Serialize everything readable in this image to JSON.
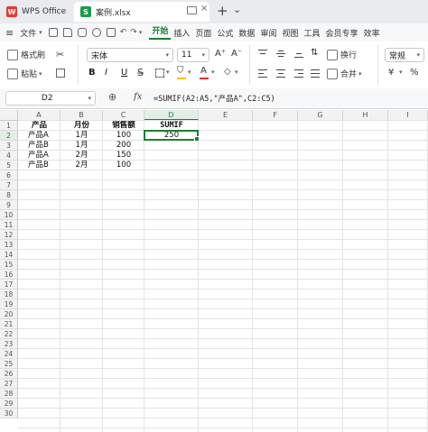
{
  "titlebar": {
    "app_tab": "WPS Office",
    "file_tab": "案例.xlsx",
    "new_tab_symbol": "+",
    "dropdown_symbol": "⌄"
  },
  "menu": {
    "file_label": "文件",
    "items": [
      "开始",
      "插入",
      "页面",
      "公式",
      "数据",
      "审阅",
      "视图",
      "工具",
      "会员专享",
      "效率"
    ],
    "active_index": 0
  },
  "ribbon": {
    "format_painter": "格式刷",
    "paste": "粘贴",
    "font_name": "宋体",
    "font_size": "11",
    "wrap_text": "换行",
    "merge": "合并",
    "number_format": "常规",
    "bold": "B",
    "italic": "I",
    "underline": "U"
  },
  "formula_bar": {
    "cell_ref": "D2",
    "fx_label": "fx",
    "formula": "=SUMIF(A2:A5,\"产品A\",C2:C5)"
  },
  "grid": {
    "columns": [
      "A",
      "B",
      "C",
      "D",
      "E",
      "F",
      "G",
      "H",
      "I"
    ],
    "selected_column": "D",
    "row_numbers": [
      "1",
      "2",
      "3",
      "4",
      "5",
      "6",
      "7",
      "8",
      "9",
      "10",
      "11",
      "12",
      "13",
      "14",
      "15",
      "16",
      "17",
      "18",
      "19",
      "20",
      "21",
      "22",
      "23",
      "24",
      "25",
      "26",
      "27",
      "28",
      "29",
      "30"
    ],
    "selected_row": "2",
    "headers": {
      "A": "产品",
      "B": "月份",
      "C": "销售额",
      "D": "SUMIF"
    },
    "rows": [
      {
        "A": "产品A",
        "B": "1月",
        "C": "100",
        "D": "250"
      },
      {
        "A": "产品B",
        "B": "1月",
        "C": "200",
        "D": ""
      },
      {
        "A": "产品A",
        "B": "2月",
        "C": "150",
        "D": ""
      },
      {
        "A": "产品B",
        "B": "2月",
        "C": "100",
        "D": ""
      }
    ]
  },
  "colors": {
    "accent": "#1e7e34",
    "wps_red": "#e63b2e",
    "sheet_green": "#1a9c4a"
  }
}
